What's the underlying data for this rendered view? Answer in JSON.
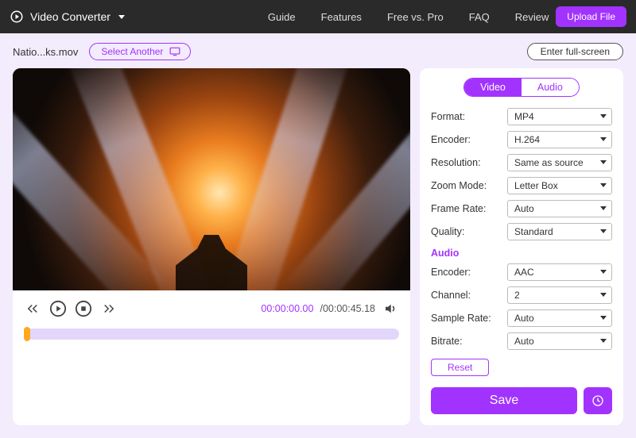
{
  "header": {
    "brand": "Video Converter",
    "nav": {
      "guide": "Guide",
      "features": "Features",
      "freepro": "Free vs. Pro",
      "faq": "FAQ",
      "review": "Review"
    },
    "upload_label": "Upload File"
  },
  "subheader": {
    "filename": "Natio...ks.mov",
    "select_another_label": "Select Another",
    "enter_fullscreen_label": "Enter full-screen"
  },
  "player": {
    "time_current": "00:00:00.00",
    "time_duration": "00:00:45.18",
    "time_separator": "/"
  },
  "settings": {
    "tabs": {
      "video": "Video",
      "audio": "Audio"
    },
    "video_section": {
      "format": {
        "label": "Format:",
        "value": "MP4"
      },
      "encoder": {
        "label": "Encoder:",
        "value": "H.264"
      },
      "resolution": {
        "label": "Resolution:",
        "value": "Same as source"
      },
      "zoom_mode": {
        "label": "Zoom Mode:",
        "value": "Letter Box"
      },
      "frame_rate": {
        "label": "Frame Rate:",
        "value": "Auto"
      },
      "quality": {
        "label": "Quality:",
        "value": "Standard"
      }
    },
    "audio_heading": "Audio",
    "audio_section": {
      "encoder": {
        "label": "Encoder:",
        "value": "AAC"
      },
      "channel": {
        "label": "Channel:",
        "value": "2"
      },
      "sample_rate": {
        "label": "Sample Rate:",
        "value": "Auto"
      },
      "bitrate": {
        "label": "Bitrate:",
        "value": "Auto"
      }
    },
    "reset_label": "Reset",
    "save_label": "Save"
  }
}
